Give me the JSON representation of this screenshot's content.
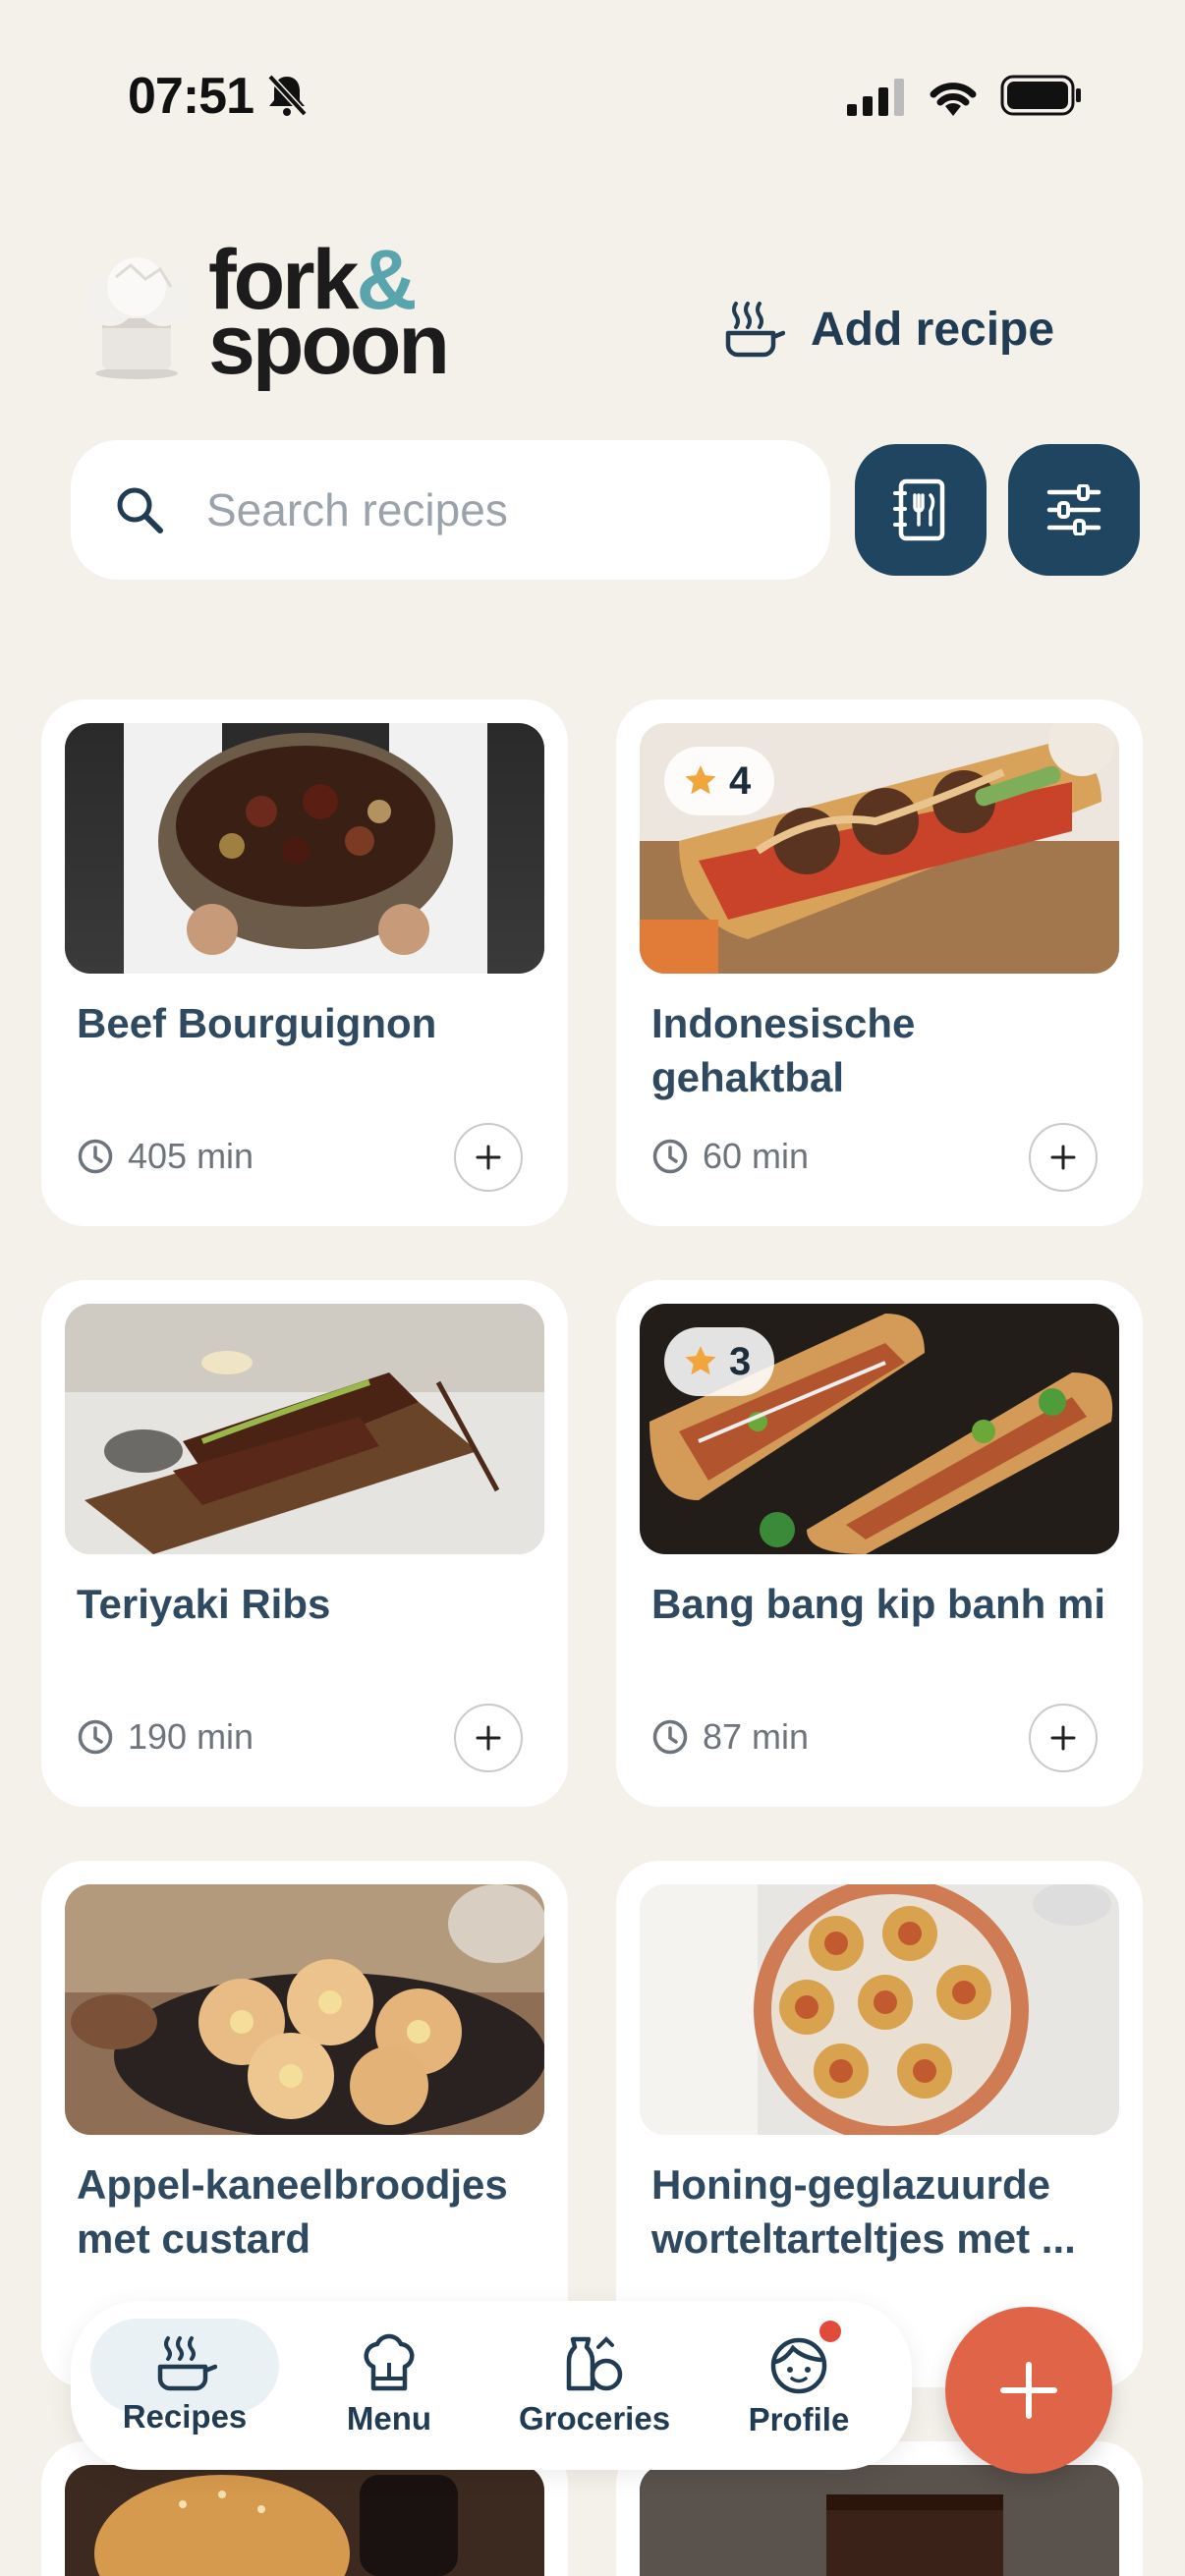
{
  "status_bar": {
    "time": "07:51"
  },
  "header": {
    "logo_line1": "fork",
    "logo_amp": "&",
    "logo_line2": "spoon",
    "add_recipe_label": "Add recipe"
  },
  "search": {
    "placeholder": "Search recipes"
  },
  "recipes": [
    {
      "title": "Beef Bourguignon",
      "time": "405 min",
      "rating": null
    },
    {
      "title": "Indonesische gehaktbal",
      "time": "60 min",
      "rating": "4"
    },
    {
      "title": "Teriyaki Ribs",
      "time": "190 min",
      "rating": null
    },
    {
      "title": "Bang bang kip banh mi",
      "time": "87 min",
      "rating": "3"
    },
    {
      "title": "Appel-kaneelbroodjes met custard",
      "time": "",
      "rating": null
    },
    {
      "title": "Honing-geglazuurde worteltarteltjes met ...",
      "time": "",
      "rating": null
    }
  ],
  "bottom_nav": {
    "items": [
      {
        "label": "Recipes",
        "active": true
      },
      {
        "label": "Menu",
        "active": false
      },
      {
        "label": "Groceries",
        "active": false
      },
      {
        "label": "Profile",
        "active": false
      }
    ]
  },
  "icons": {
    "search": "search-icon",
    "menu_book": "menu-book-icon",
    "filters": "filter-sliders-icon",
    "add": "plus-icon",
    "clock": "clock-icon",
    "star": "star-icon",
    "pot": "cooking-pot-icon",
    "chef_hat": "chef-hat-icon",
    "groceries": "groceries-icon",
    "profile": "profile-face-icon"
  },
  "colors": {
    "background": "#f4f1ea",
    "primary": "#1f4560",
    "accent": "#e06448",
    "logo_accent": "#5aa5ad",
    "star": "#f0a63a"
  }
}
